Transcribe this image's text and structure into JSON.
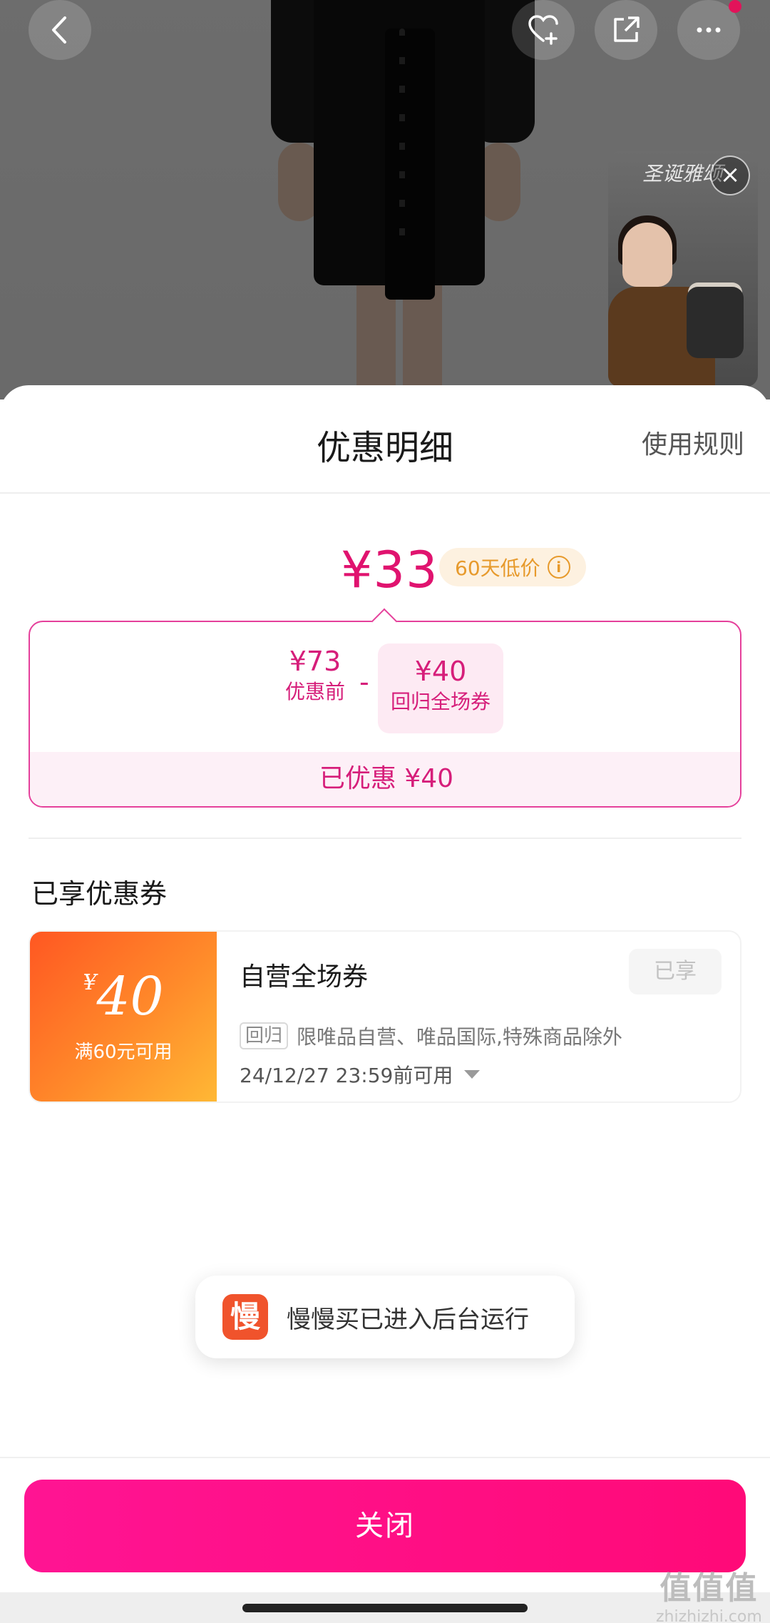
{
  "background": {
    "video_title": "圣诞雅颂"
  },
  "sheet": {
    "title": "优惠明细",
    "rules_link": "使用规则",
    "final_price": "¥33",
    "low_price_badge": "60天低价",
    "breakdown": {
      "original_value": "¥73",
      "original_label": "优惠前",
      "minus": "-",
      "coupon_value": "¥40",
      "coupon_label": "回归全场券",
      "total_saved": "已优惠 ¥40"
    },
    "coupons_section_title": "已享优惠券",
    "coupon": {
      "currency": "¥",
      "amount": "40",
      "condition": "满60元可用",
      "name": "自营全场券",
      "status": "已享",
      "tag": "回归",
      "description": "限唯品自营、唯品国际,特殊商品除外",
      "expiry": "24/12/27 23:59前可用"
    },
    "toast": {
      "icon_char": "慢",
      "message": "慢慢买已进入后台运行"
    },
    "close_button": "关闭"
  },
  "watermark": {
    "main": "值值值",
    "site": "zhizhizhi.com"
  },
  "colors": {
    "accent_pink": "#e0136f",
    "close_button": "#ff0a78",
    "coupon_orange": "#ff8a2a",
    "badge_orange": "#e79a2c"
  }
}
